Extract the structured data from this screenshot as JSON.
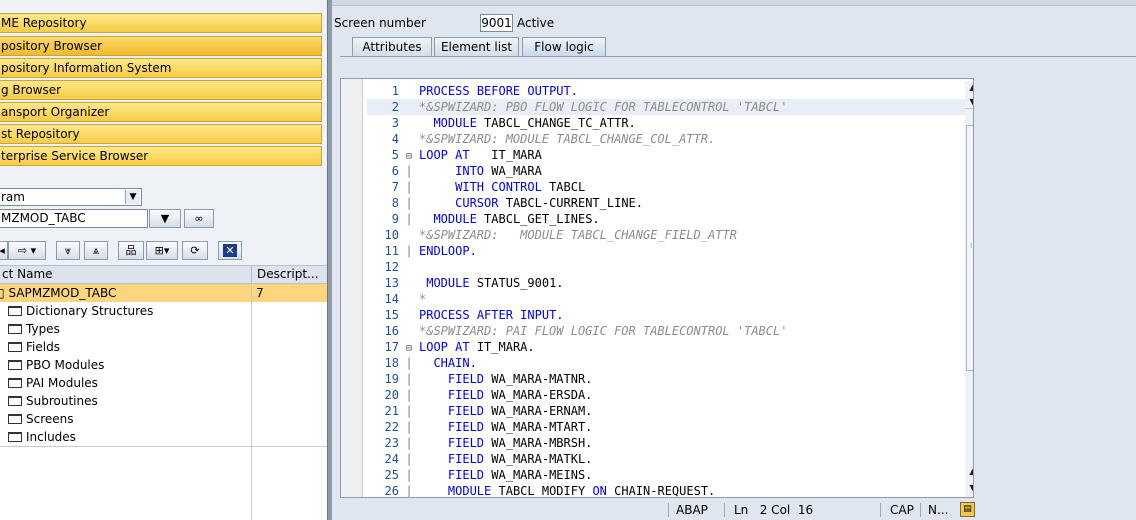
{
  "nav": {
    "items": [
      {
        "label": "ME Repository",
        "active": false
      },
      {
        "label": "pository Browser",
        "active": true
      },
      {
        "label": "pository Information System",
        "active": false
      },
      {
        "label": "g Browser",
        "active": false
      },
      {
        "label": "ansport Organizer",
        "active": false
      },
      {
        "label": "st Repository",
        "active": false
      },
      {
        "label": "terprise Service Browser",
        "active": false
      }
    ],
    "object_type": "ram",
    "object_name": "MZMOD_TABC"
  },
  "tree": {
    "header_name": "ct Name",
    "header_desc": "Descript...",
    "root": {
      "label": "SAPMZMOD_TABC",
      "desc": "7"
    },
    "children": [
      "Dictionary Structures",
      "Types",
      "Fields",
      "PBO Modules",
      "PAI Modules",
      "Subroutines",
      "Screens",
      "Includes"
    ]
  },
  "screen": {
    "label": "Screen number",
    "number": "9001",
    "status": "Active"
  },
  "tabs": [
    "Attributes",
    "Element list",
    "Flow logic"
  ],
  "active_tab": "Flow logic",
  "code_lines": [
    {
      "n": "1",
      "text": "PROCESS BEFORE OUTPUT.",
      "type": "kw",
      "indent": 0
    },
    {
      "n": "2",
      "text": "*&SPWIZARD: PBO FLOW LOGIC FOR TABLECONTROL 'TABCL'",
      "type": "cm",
      "indent": 0
    },
    {
      "n": "3",
      "text": "  MODULE TABCL_CHANGE_TC_ATTR.",
      "type": "mix",
      "indent": 0
    },
    {
      "n": "4",
      "text": "*&SPWIZARD: MODULE TABCL_CHANGE_COL_ATTR.",
      "type": "cm",
      "indent": 0
    },
    {
      "n": "5",
      "text": "LOOP AT   IT_MARA",
      "type": "mix",
      "indent": 1
    },
    {
      "n": "6",
      "text": "     INTO WA_MARA",
      "type": "mix",
      "indent": 1
    },
    {
      "n": "7",
      "text": "     WITH CONTROL TABCL",
      "type": "mix",
      "indent": 1
    },
    {
      "n": "8",
      "text": "     CURSOR TABCL-CURRENT_LINE.",
      "type": "mix",
      "indent": 1
    },
    {
      "n": "9",
      "text": "  MODULE TABCL_GET_LINES.",
      "type": "mix",
      "indent": 1
    },
    {
      "n": "10",
      "text": "*&SPWIZARD:   MODULE TABCL_CHANGE_FIELD_ATTR",
      "type": "cm",
      "indent": 0
    },
    {
      "n": "11",
      "text": "ENDLOOP.",
      "type": "kw",
      "indent": 1
    },
    {
      "n": "12",
      "text": "",
      "type": "tx",
      "indent": 0
    },
    {
      "n": "13",
      "text": " MODULE STATUS_9001.",
      "type": "mix",
      "indent": 0
    },
    {
      "n": "14",
      "text": "*",
      "type": "cm",
      "indent": 0
    },
    {
      "n": "15",
      "text": "PROCESS AFTER INPUT.",
      "type": "kw",
      "indent": 0
    },
    {
      "n": "16",
      "text": "*&SPWIZARD: PAI FLOW LOGIC FOR TABLECONTROL 'TABCL'",
      "type": "cm",
      "indent": 0
    },
    {
      "n": "17",
      "text": "LOOP AT IT_MARA.",
      "type": "mix",
      "indent": 1
    },
    {
      "n": "18",
      "text": "  CHAIN.",
      "type": "kw",
      "indent": 1
    },
    {
      "n": "19",
      "text": "    FIELD WA_MARA-MATNR.",
      "type": "mix",
      "indent": 1
    },
    {
      "n": "20",
      "text": "    FIELD WA_MARA-ERSDA.",
      "type": "mix",
      "indent": 1
    },
    {
      "n": "21",
      "text": "    FIELD WA_MARA-ERNAM.",
      "type": "mix",
      "indent": 1
    },
    {
      "n": "22",
      "text": "    FIELD WA_MARA-MTART.",
      "type": "mix",
      "indent": 1
    },
    {
      "n": "23",
      "text": "    FIELD WA_MARA-MBRSH.",
      "type": "mix",
      "indent": 1
    },
    {
      "n": "24",
      "text": "    FIELD WA_MARA-MATKL.",
      "type": "mix",
      "indent": 1
    },
    {
      "n": "25",
      "text": "    FIELD WA_MARA-MEINS.",
      "type": "mix",
      "indent": 1
    },
    {
      "n": "26",
      "text": "    MODULE TABCL_MODIFY ON CHAIN-REQUEST.",
      "type": "mix",
      "indent": 1
    }
  ],
  "status": {
    "lang": "ABAP",
    "position": "Ln   2 Col  16",
    "caps": "CAP",
    "num": "N..."
  },
  "icons": {
    "dropdown": "chevron-down-icon",
    "display": "glasses-icon",
    "close": "close-icon"
  }
}
